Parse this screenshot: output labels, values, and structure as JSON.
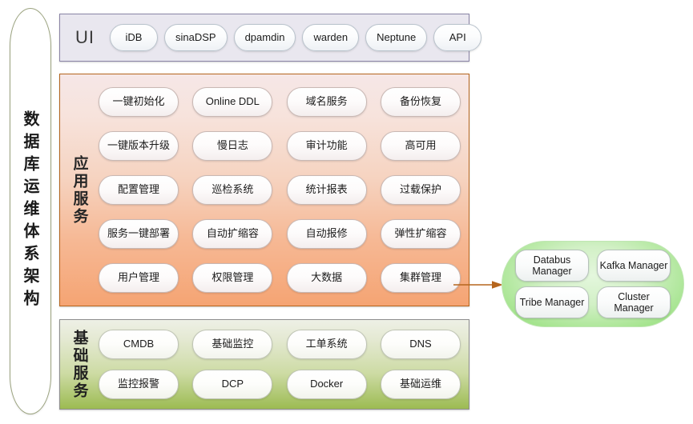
{
  "diagram": {
    "vertical_title": "数据库运维体系架构",
    "bands": {
      "ui": {
        "label": "UI",
        "items": [
          "iDB",
          "sinaDSP",
          "dpamdin",
          "warden",
          "Neptune",
          "API"
        ]
      },
      "app_services": {
        "label": "应用服务",
        "rows": [
          [
            "一键初始化",
            "Online DDL",
            "域名服务",
            "备份恢复"
          ],
          [
            "一键版本升级",
            "慢日志",
            "审计功能",
            "高可用"
          ],
          [
            "配置管理",
            "巡检系统",
            "统计报表",
            "过载保护"
          ],
          [
            "服务一键部署",
            "自动扩缩容",
            "自动报修",
            "弹性扩缩容"
          ],
          [
            "用户管理",
            "权限管理",
            "大数据",
            "集群管理"
          ]
        ]
      },
      "base_services": {
        "label": "基础服务",
        "rows": [
          [
            "CMDB",
            "基础监控",
            "工单系统",
            "DNS"
          ],
          [
            "监控报警",
            "DCP",
            "Docker",
            "基础运维"
          ]
        ]
      }
    },
    "cluster_group": {
      "rows": [
        [
          "Databus Manager",
          "Kafka Manager"
        ],
        [
          "Tribe Manager",
          "Cluster Manager"
        ]
      ]
    },
    "connector": {
      "from": "集群管理",
      "to": "cluster-group",
      "color": "#b5651d"
    },
    "colors": {
      "ui_band_fill": "#e9e7ef",
      "ui_band_border": "#8a84a6",
      "app_band_top": "#f6e7e7",
      "app_band_bottom": "#f5a473",
      "app_band_border": "#b5651d",
      "base_band_top": "#eef0e6",
      "base_band_bottom": "#9cbb52",
      "base_band_border": "#8d8d8d",
      "cluster_fill": "#8ede73",
      "vertical_title_border": "#9ba37f"
    }
  }
}
